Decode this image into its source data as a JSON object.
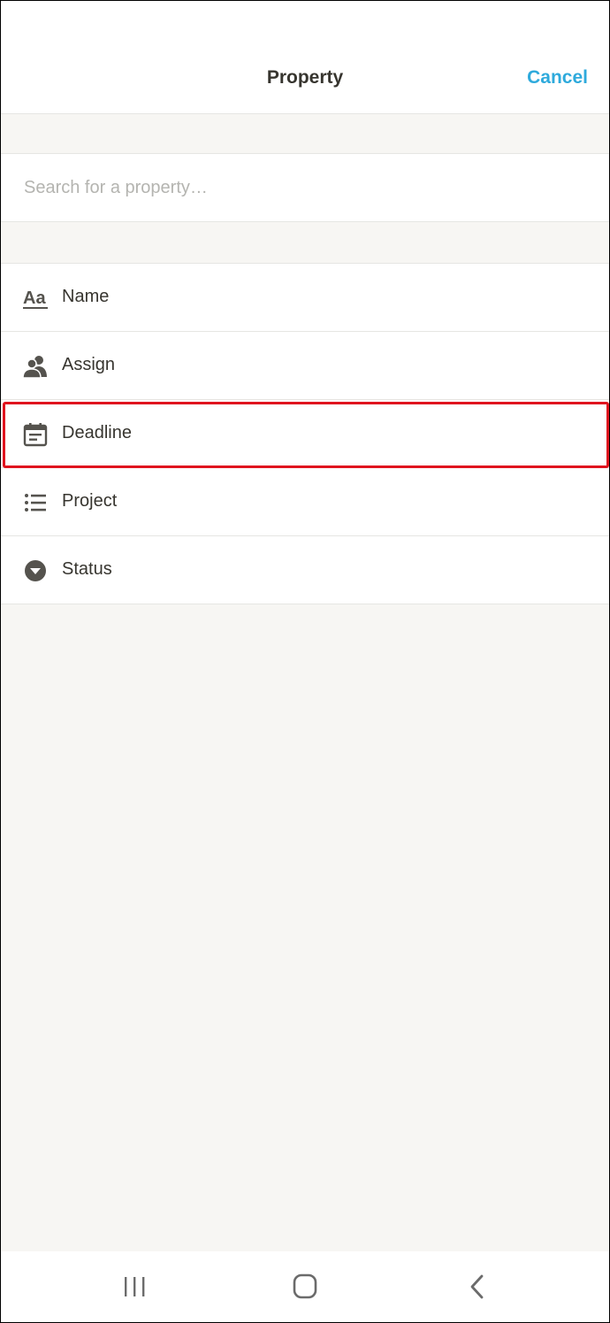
{
  "header": {
    "title": "Property",
    "cancel_label": "Cancel"
  },
  "search": {
    "placeholder": "Search for a property…",
    "value": ""
  },
  "properties": [
    {
      "label": "Name",
      "icon": "text-aa-icon"
    },
    {
      "label": "Assign",
      "icon": "person-icon"
    },
    {
      "label": "Deadline",
      "icon": "calendar-icon",
      "highlighted": true
    },
    {
      "label": "Project",
      "icon": "bulleted-list-icon"
    },
    {
      "label": "Status",
      "icon": "select-triangle-icon"
    }
  ],
  "navbar": {
    "buttons": [
      "recent-apps",
      "home",
      "back"
    ]
  },
  "colors": {
    "accent": "#2eaadc",
    "highlight": "#e0141e",
    "text": "#37352f",
    "icon": "#55534e",
    "background": "#f7f6f3"
  }
}
